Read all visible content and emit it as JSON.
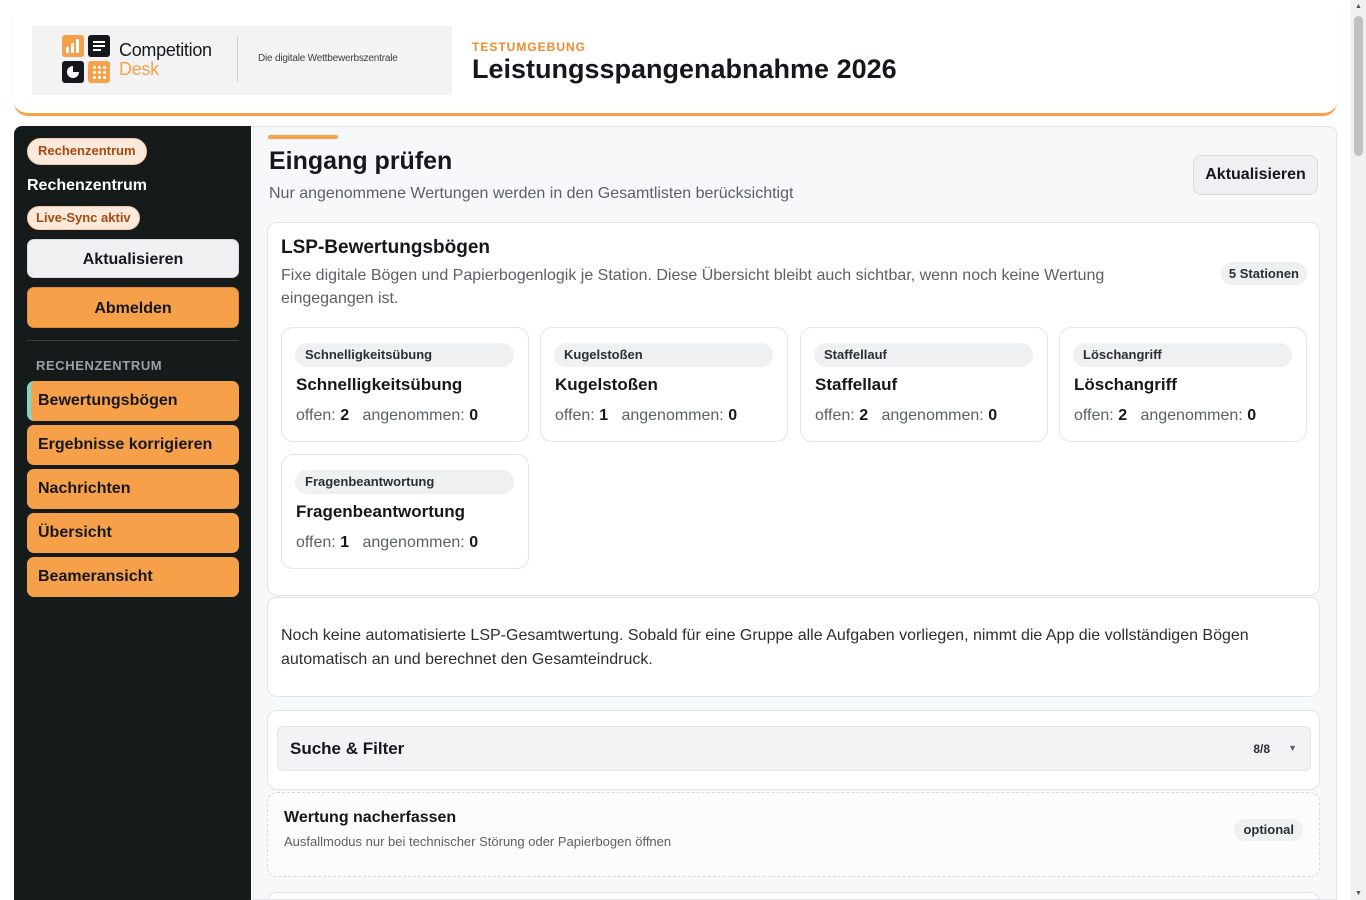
{
  "brand": {
    "name_line1": "Competition",
    "name_line2": "Desk",
    "tagline": "Die digitale Wettbewerbszentrale",
    "colors": {
      "orange": "#f7a04a",
      "dark": "#151a1b",
      "teal": "#7fd7c8"
    }
  },
  "header": {
    "env_label": "TESTUMGEBUNG",
    "title": "Leistungsspangenabnahme 2026"
  },
  "sidebar": {
    "role_badge": "Rechenzentrum",
    "user_name": "Rechenzentrum",
    "sync_badge": "Live-Sync aktiv",
    "refresh_label": "Aktualisieren",
    "logout_label": "Abmelden",
    "section_label": "RECHENZENTRUM",
    "nav": [
      {
        "label": "Bewertungsbögen",
        "active": true
      },
      {
        "label": "Ergebnisse korrigieren",
        "active": false
      },
      {
        "label": "Nachrichten",
        "active": false
      },
      {
        "label": "Übersicht",
        "active": false
      },
      {
        "label": "Beameransicht",
        "active": false
      }
    ]
  },
  "main": {
    "title": "Eingang prüfen",
    "subtitle": "Nur angenommene Wertungen werden in den Gesamtlisten berücksichtigt",
    "refresh_label": "Aktualisieren",
    "lsp": {
      "title": "LSP-Bewertungsbögen",
      "description": "Fixe digitale Bögen und Papierbogenlogik je Station. Diese Übersicht bleibt auch sichtbar, wenn noch keine Wertung eingegangen ist.",
      "station_count_badge": "5 Stationen",
      "open_label": "offen:",
      "accepted_label": "angenommen:",
      "stations": [
        {
          "tag": "Schnelligkeitsübung",
          "name": "Schnelligkeitsübung",
          "open": "2",
          "accepted": "0"
        },
        {
          "tag": "Kugelstoßen",
          "name": "Kugelstoßen",
          "open": "1",
          "accepted": "0"
        },
        {
          "tag": "Staffellauf",
          "name": "Staffellauf",
          "open": "2",
          "accepted": "0"
        },
        {
          "tag": "Löschangriff",
          "name": "Löschangriff",
          "open": "2",
          "accepted": "0"
        },
        {
          "tag": "Fragenbeantwortung",
          "name": "Fragenbeantwortung",
          "open": "1",
          "accepted": "0"
        }
      ]
    },
    "note": "Noch keine automatisierte LSP-Gesamtwertung. Sobald für eine Gruppe alle Aufgaben vorliegen, nimmt die App die vollständigen Bögen automatisch an und berechnet den Gesamteindruck.",
    "filter": {
      "title": "Suche & Filter",
      "count": "8/8",
      "chevron_icon": "chevron-down-icon"
    },
    "followup": {
      "title": "Wertung nacherfassen",
      "subtitle": "Ausfallmodus nur bei technischer Störung oder Papierbogen öffnen",
      "badge": "optional"
    }
  }
}
